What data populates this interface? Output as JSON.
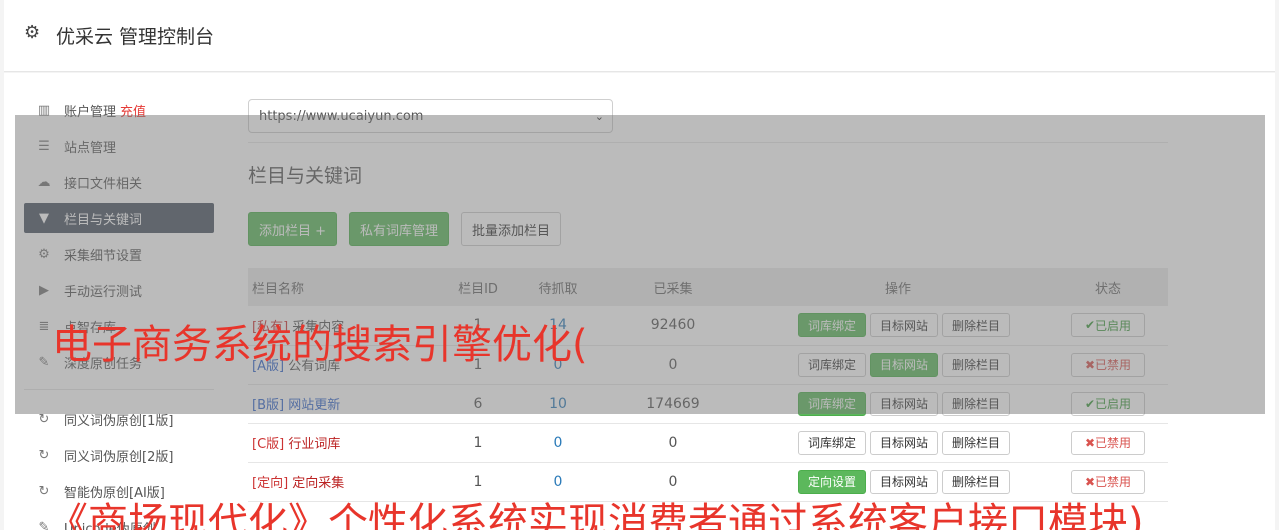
{
  "header": {
    "title": "优采云 管理控制台",
    "icon": "gear-icon"
  },
  "sidebar": {
    "items": [
      {
        "label": "账户管理",
        "extra": "充值",
        "icon": "bar-chart-icon"
      },
      {
        "label": "站点管理",
        "icon": "server-icon"
      },
      {
        "label": "接口文件相关",
        "icon": "cloud-upload-icon"
      },
      {
        "label": "栏目与关键词",
        "icon": "filter-icon",
        "active": true
      },
      {
        "label": "采集细节设置",
        "icon": "cogs-icon"
      },
      {
        "label": "手动运行测试",
        "icon": "play-circle-icon"
      },
      {
        "label": "点智存库",
        "icon": "database-icon"
      },
      {
        "label": "深度原创任务",
        "icon": "edit-icon"
      }
    ],
    "items2": [
      {
        "label": "同义词伪原创[1版]",
        "icon": "refresh-icon"
      },
      {
        "label": "同义词伪原创[2版]",
        "icon": "refresh-icon"
      },
      {
        "label": "智能伪原创[AI版]",
        "icon": "refresh-icon"
      },
      {
        "label": "Unicode伪原创",
        "icon": "edit-icon"
      }
    ]
  },
  "site_select": {
    "value": "https://www.ucaiyun.com"
  },
  "section_title": "栏目与关键词",
  "buttons": {
    "add_column": "添加栏目 +",
    "private_lib": "私有词库管理",
    "batch_add": "批量添加栏目"
  },
  "table": {
    "headers": [
      "栏目名称",
      "栏目ID",
      "待抓取",
      "已采集",
      "操作",
      "状态"
    ],
    "rows": [
      {
        "prefix": "[私有]",
        "name": "采集内容",
        "id": "1",
        "pending": "14",
        "collected": "92460",
        "op1": "词库绑定",
        "op2": "目标网站",
        "op3": "删除栏目",
        "status": "已启用"
      },
      {
        "prefix": "[A版]",
        "name": "公有词库",
        "id": "1",
        "pending": "0",
        "collected": "0",
        "op1": "词库绑定",
        "op2": "目标网站",
        "op3": "删除栏目",
        "status": "已禁用"
      },
      {
        "prefix": "[B版]",
        "name": "网站更新",
        "id": "6",
        "pending": "10",
        "collected": "174669",
        "op1": "词库绑定",
        "op2": "目标网站",
        "op3": "删除栏目",
        "status": "已启用"
      },
      {
        "prefix": "[C版]",
        "name": "行业词库",
        "id": "1",
        "pending": "0",
        "collected": "0",
        "op1": "词库绑定",
        "op2": "目标网站",
        "op3": "删除栏目",
        "status": "已禁用"
      },
      {
        "prefix": "[定向]",
        "name": "定向采集",
        "id": "1",
        "pending": "0",
        "collected": "0",
        "op1": "定向设置",
        "op2": "目标网站",
        "op3": "删除栏目",
        "status": "已禁用"
      }
    ]
  },
  "watermark": {
    "line1": "电子商务系统的搜索引擎优化(",
    "line2": "《商场现代化》个性化系统实现消费者通过系统客户接口模块)"
  },
  "colors": {
    "accent_green": "#5cb85c",
    "active_nav": "#4a5563",
    "watermark": "#e8352b"
  }
}
